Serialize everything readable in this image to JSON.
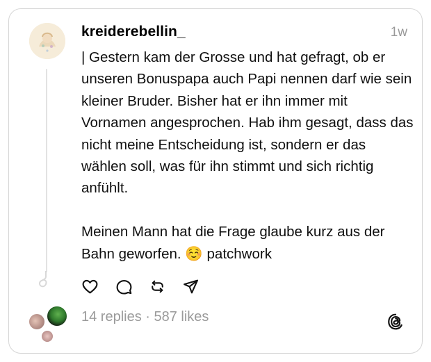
{
  "post": {
    "username": "kreiderebellin_",
    "timestamp": "1w",
    "text": "| Gestern kam der Grosse und hat gefragt, ob er unseren Bonuspapa auch Papi nennen darf wie sein kleiner Bruder. Bisher hat er ihn immer mit Vornamen angesprochen. Hab ihm gesagt, dass das nicht meine Entscheidung ist, sondern er das wählen soll, was für ihn stimmt und sich richtig anfühlt.\n\nMeinen Mann hat die Frage glaube kurz aus der Bahn geworfen. ☺️ patchwork"
  },
  "stats": {
    "text": "14 replies · 587 likes"
  },
  "icons": {
    "like": "heart-icon",
    "reply": "speech-bubble-icon",
    "repost": "repost-icon",
    "share": "send-icon",
    "brand": "threads-logo-icon"
  },
  "colors": {
    "text": "#101010",
    "muted": "#9a9a9a",
    "border": "#d6d6d6",
    "thread_line": "#e2e2e2"
  }
}
